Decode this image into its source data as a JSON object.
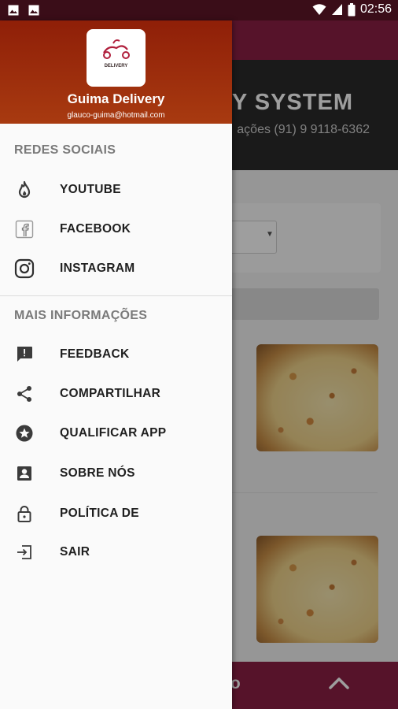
{
  "status_bar": {
    "time": "02:56",
    "icons": [
      "image-icon",
      "image-icon",
      "wifi-icon",
      "signal-icon",
      "battery-icon"
    ]
  },
  "background_app": {
    "hero_title": "RY SYSTEM",
    "hero_subtitle": "ações (91) 9 9118-6362",
    "bottom_label": "do",
    "colors": {
      "app_bar": "#8c1f45",
      "hero": "#2b2b2b"
    }
  },
  "drawer": {
    "header": {
      "logo_text": "DELIVERY",
      "app_name": "Guima Delivery",
      "email": "glauco-guima@hotmail.com",
      "color": "#9a2a0c"
    },
    "sections": [
      {
        "title": "REDES SOCIAIS",
        "items": [
          {
            "label": "YOUTUBE",
            "icon": "flame-icon"
          },
          {
            "label": "FACEBOOK",
            "icon": "facebook-icon"
          },
          {
            "label": "INSTAGRAM",
            "icon": "instagram-icon"
          }
        ]
      },
      {
        "title": "MAIS INFORMAÇÕES",
        "items": [
          {
            "label": "FEEDBACK",
            "icon": "feedback-icon"
          },
          {
            "label": "COMPARTILHAR",
            "icon": "share-icon"
          },
          {
            "label": "QUALIFICAR APP",
            "icon": "star-icon"
          },
          {
            "label": "SOBRE NÓS",
            "icon": "contact-icon"
          },
          {
            "label": "POLÍTICA DE",
            "icon": "lock-icon"
          },
          {
            "label": "SAIR",
            "icon": "exit-icon"
          }
        ]
      }
    ]
  }
}
